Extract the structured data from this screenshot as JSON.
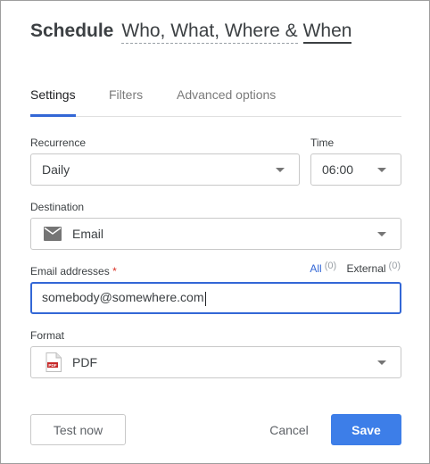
{
  "dialog": {
    "title": "Schedule",
    "subtitle_part1": "Who, What, Where &",
    "subtitle_part2": "When"
  },
  "tabs": [
    {
      "label": "Settings",
      "active": true
    },
    {
      "label": "Filters",
      "active": false
    },
    {
      "label": "Advanced options",
      "active": false
    }
  ],
  "recurrence": {
    "label": "Recurrence",
    "value": "Daily"
  },
  "time": {
    "label": "Time",
    "value": "06:00"
  },
  "destination": {
    "label": "Destination",
    "value": "Email",
    "icon": "envelope-icon"
  },
  "email": {
    "label": "Email addresses",
    "required_mark": "*",
    "value": "somebody@somewhere.com",
    "all_label": "All",
    "all_count": "(0)",
    "external_label": "External",
    "external_count": "(0)"
  },
  "format": {
    "label": "Format",
    "value": "PDF",
    "icon": "pdf-file-icon"
  },
  "buttons": {
    "test_now": "Test now",
    "cancel": "Cancel",
    "save": "Save"
  },
  "colors": {
    "accent": "#3367d6",
    "save_button": "#3d7ee8",
    "required": "#d93025"
  }
}
